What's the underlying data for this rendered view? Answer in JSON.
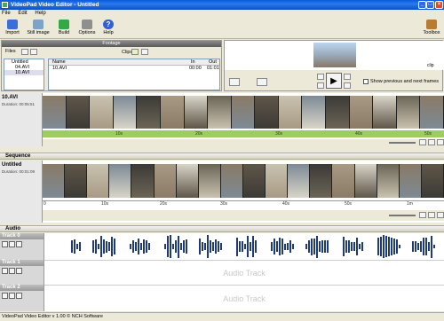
{
  "window": {
    "title": "VideoPad Video Editor - Untitled"
  },
  "menu": [
    "File",
    "Edit",
    "Help"
  ],
  "toolbar": {
    "import": "Import",
    "still_image": "Still image",
    "build": "Build",
    "options": "Options",
    "help": "Help",
    "toolbox": "Toolbox"
  },
  "footage": {
    "header": "Footage",
    "files_label": "Files",
    "clips_label": "Clips",
    "tree": {
      "root": "Untitled",
      "items": [
        "04.AVI",
        "10.AVI"
      ]
    },
    "columns": [
      "Name",
      "In",
      "Out"
    ],
    "rows": [
      {
        "name": "10.AVI",
        "in": "00:00",
        "out": "01:01"
      }
    ]
  },
  "preview": {
    "clip_label": "clip",
    "show_frames": "Show previous and next frames"
  },
  "clip_track": {
    "name": "10.AVI",
    "duration": "Duration: 00:05:51",
    "ticks": [
      "10s",
      "20s",
      "30s",
      "40s",
      "50s"
    ]
  },
  "sequence": {
    "header": "Sequence",
    "name": "Untitled",
    "duration": "Duration: 00:01:09",
    "ticks": [
      "0",
      "10s",
      "20s",
      "30s",
      "40s",
      "50s",
      "1m"
    ]
  },
  "audio": {
    "header": "Audio",
    "tracks": [
      {
        "name": "Track 0",
        "placeholder": ""
      },
      {
        "name": "Track 1",
        "placeholder": "Audio Track"
      },
      {
        "name": "Track 2",
        "placeholder": "Audio Track"
      }
    ]
  },
  "status": "VideoPad Video Editor v 1.00 © NCH Software",
  "colors": {
    "accent": "#0a5bd8",
    "waveform": "#1e3a7a",
    "timeline_green": "#9ccc62"
  }
}
